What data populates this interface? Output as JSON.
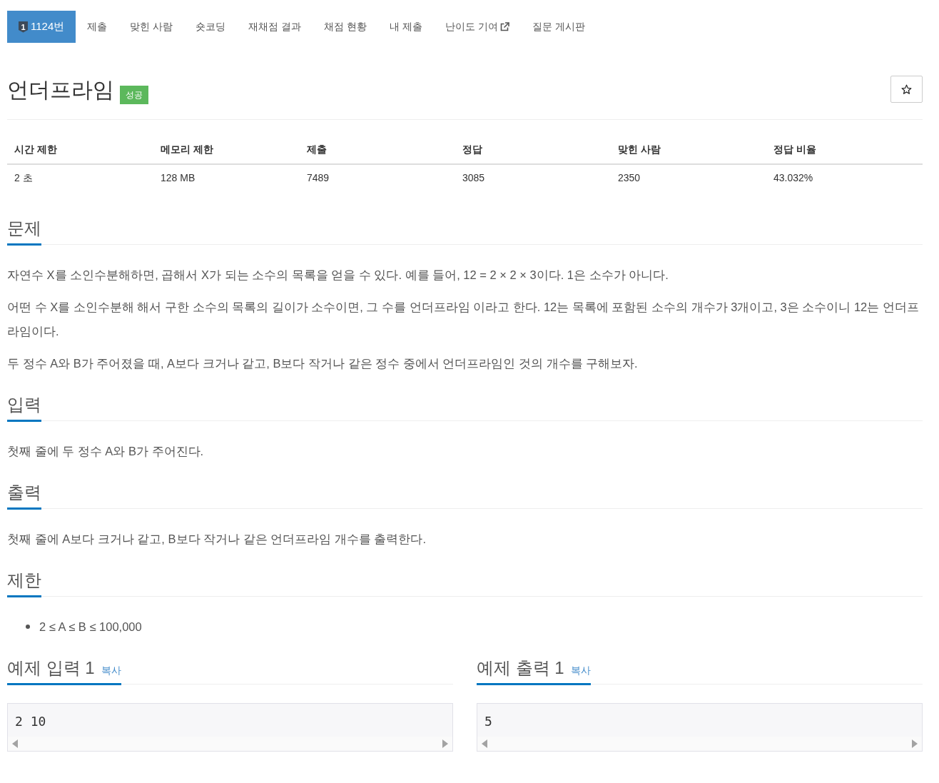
{
  "nav": {
    "tabs": [
      {
        "label": "1124번",
        "selected": true,
        "external": false,
        "level_badge": "1"
      },
      {
        "label": "제출",
        "selected": false,
        "external": false
      },
      {
        "label": "맞힌 사람",
        "selected": false,
        "external": false
      },
      {
        "label": "숏코딩",
        "selected": false,
        "external": false
      },
      {
        "label": "재채점 결과",
        "selected": false,
        "external": false
      },
      {
        "label": "채점 현황",
        "selected": false,
        "external": false
      },
      {
        "label": "내 제출",
        "selected": false,
        "external": false
      },
      {
        "label": "난이도 기여",
        "selected": false,
        "external": true
      },
      {
        "label": "질문 게시판",
        "selected": false,
        "external": false
      }
    ]
  },
  "problem": {
    "title": "언더프라임",
    "status_badge": "성공",
    "starred": false
  },
  "info_table": {
    "columns": [
      "시간 제한",
      "메모리 제한",
      "제출",
      "정답",
      "맞힌 사람",
      "정답 비율"
    ],
    "rows": [
      [
        "2 초",
        "128 MB",
        "7489",
        "3085",
        "2350",
        "43.032%"
      ]
    ]
  },
  "sections": [
    {
      "kind": "paragraphs",
      "heading": "문제",
      "paragraphs": [
        "자연수 X를 소인수분해하면, 곱해서 X가 되는 소수의 목록을 얻을 수 있다. 예를 들어, 12 = 2 × 2 × 3이다. 1은 소수가 아니다.",
        "어떤 수 X를 소인수분해 해서 구한 소수의 목록의 길이가 소수이면, 그 수를 언더프라임 이라고 한다. 12는 목록에 포함된 소수의 개수가 3개이고, 3은 소수이니 12는 언더프라임이다.",
        "두 정수 A와 B가 주어졌을 때, A보다 크거나 같고, B보다 작거나 같은 정수 중에서 언더프라임인 것의 개수를 구해보자."
      ]
    },
    {
      "kind": "paragraphs",
      "heading": "입력",
      "paragraphs": [
        "첫째 줄에 두 정수 A와 B가 주어진다."
      ]
    },
    {
      "kind": "paragraphs",
      "heading": "출력",
      "paragraphs": [
        "첫째 줄에 A보다 크거나 같고, B보다 작거나 같은 언더프라임 개수를 출력한다."
      ]
    },
    {
      "kind": "list",
      "heading": "제한",
      "items": [
        "2 ≤ A ≤ B ≤ 100,000"
      ]
    }
  ],
  "samples": [
    {
      "heading": "예제 입력 1",
      "copy_label": "복사",
      "content": "2 10"
    },
    {
      "heading": "예제 출력 1",
      "copy_label": "복사",
      "content": "5"
    }
  ]
}
